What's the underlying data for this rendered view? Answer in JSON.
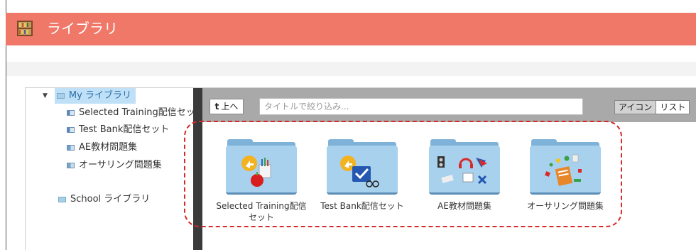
{
  "header": {
    "title": "ライブラリ"
  },
  "sidebar": {
    "root": {
      "label": "My ライブラリ",
      "items": [
        {
          "label": "Selected Training配信セット"
        },
        {
          "label": "Test Bank配信セット"
        },
        {
          "label": "AE教材問題集"
        },
        {
          "label": "オーサリング問題集"
        }
      ]
    },
    "school": {
      "label": "School ライブラリ"
    }
  },
  "toolbar": {
    "up_arrow": "t",
    "up_label": "上へ",
    "filter_placeholder": "タイトルで絞り込み...",
    "view_icon_label": "アイコン",
    "view_list_label": "リスト"
  },
  "folders": [
    {
      "label": "Selected Training配信セット",
      "icon": "training-folder-icon"
    },
    {
      "label": "Test Bank配信セット",
      "icon": "testbank-folder-icon"
    },
    {
      "label": "AE教材問題集",
      "icon": "ae-materials-folder-icon"
    },
    {
      "label": "オーサリング問題集",
      "icon": "authoring-folder-icon"
    }
  ],
  "colors": {
    "header_bg": "#f07868",
    "toolbar_bg": "#a9a9a9",
    "splitter": "#3a3a3a",
    "selected_bg": "#bfe0f7",
    "folder_front": "#a8d1ee",
    "highlight_dash": "#d62a2a"
  }
}
